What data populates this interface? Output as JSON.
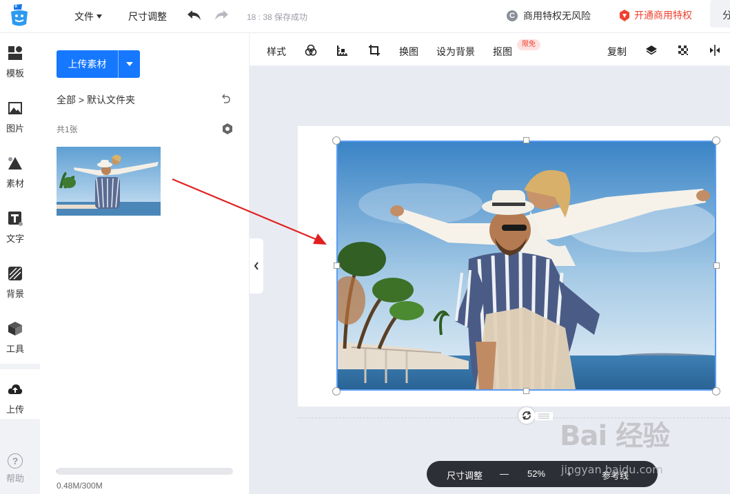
{
  "topbar": {
    "file_menu": "文件",
    "resize": "尺寸调整",
    "save_status": "18 : 38  保存成功",
    "commercial_badge_icon": "C",
    "commercial": "商用特权无风险",
    "open_commercial": "开通商用特权",
    "share": "分"
  },
  "iconbar": {
    "items": [
      {
        "label": "模板",
        "icon": "template-icon"
      },
      {
        "label": "图片",
        "icon": "image-icon"
      },
      {
        "label": "素材",
        "icon": "shapes-icon"
      },
      {
        "label": "文字",
        "icon": "text-icon"
      },
      {
        "label": "背景",
        "icon": "background-icon"
      },
      {
        "label": "工具",
        "icon": "tools-icon"
      },
      {
        "label": "上传",
        "icon": "upload-cloud-icon"
      }
    ],
    "help_label": "帮助",
    "help_icon": "?"
  },
  "panel": {
    "upload_button": "上传素材",
    "breadcrumb": "全部 > 默认文件夹",
    "count": "共1张",
    "storage_text": "0.48M/300M",
    "storage_fraction": 0.0016
  },
  "toolbar": {
    "style": "样式",
    "replace": "换图",
    "set_background": "设为背景",
    "cutout": "抠图",
    "cutout_badge": "限免",
    "copy": "复制"
  },
  "bottombar": {
    "resize": "尺寸调整",
    "minus": "—",
    "zoom": "52%",
    "plus": "+",
    "guides": "参考线"
  },
  "watermark": {
    "brand": "Bai 经验",
    "url": "jingyan.baidu.com"
  },
  "colors": {
    "accent": "#1677ff",
    "danger": "#f0412f",
    "selection": "#5b9cf5",
    "annotation_arrow": "#e02020"
  }
}
